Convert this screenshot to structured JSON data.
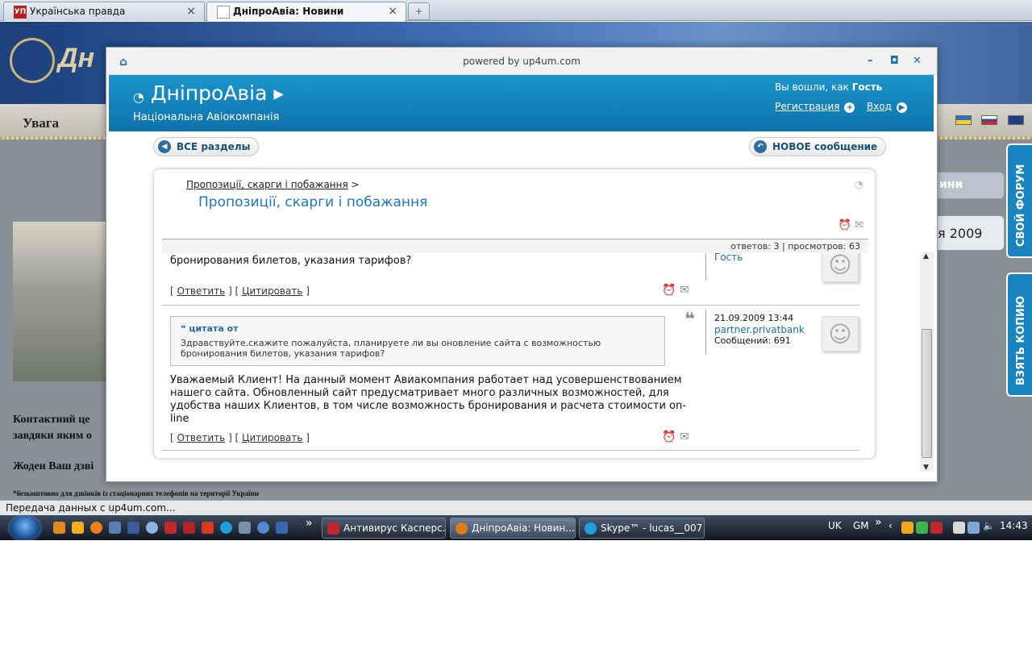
{
  "browser": {
    "tabs": [
      {
        "label": "Українська правда",
        "favicon": "УП",
        "active": false
      },
      {
        "label": "ДніпроАвіа: Новини",
        "active": true
      }
    ],
    "close_glyph": "×",
    "newtab_glyph": "+"
  },
  "site": {
    "nav_label": "Увага",
    "right_box1": "ини",
    "right_box2": "я 2009",
    "side_tab1": "СВОЙ ФОРУМ",
    "side_tab2": "ВЗЯТЬ КОПИЮ",
    "text1": "Контактний це",
    "text2": "завдяки яким о",
    "text3": "Жоден Ваш дзві",
    "footnote": "*безкоштовно для дзвінків із стаціонарних телефонів на території України"
  },
  "modal": {
    "powered": "powered by up4um.com",
    "controls": {
      "minimize": "–",
      "maximize": "◘",
      "close": "✕"
    },
    "banner": {
      "title": "ДніпроАвіа",
      "subtitle": "Національна Авіокомпанія",
      "login_prefix": "Вы вошли, как",
      "login_user": "Гость",
      "register": "Регистрация",
      "enter": "Вход"
    },
    "btn_all": "ВСЕ разделы",
    "btn_new": "НОВОЕ сообщение",
    "breadcrumb": "Пропозиції, скарги і побажання",
    "breadcrumb_sep": ">",
    "topic_title": "Пропозиції, скарги і побажання",
    "stats": "ответов: 3 | просмотров: 63",
    "posts": [
      {
        "text": "бронирования билетов, указания тарифов?",
        "user": "Гость",
        "reply": "Ответить",
        "quote": "Цитировать"
      },
      {
        "quote_header": "цитата от",
        "quote_text": "Здравствуйте.скажите пожалуйста, планируете ли вы оновление сайта с возможностью бронирования билетов, указания тарифов?",
        "date": "21.09.2009 13:44",
        "user": "partner.privatbank",
        "messages": "Сообщений: 691",
        "text": "Уважаемый Клиент! На данный момент Авиакомпания работает над усовершенствованием нашего сайта. Обновленный сайт предусматривает много различных возможностей, для удобства наших Клиентов, в том числе возможность бронирования и расчета стоимости on-line",
        "reply": "Ответить",
        "quote": "Цитировать"
      }
    ]
  },
  "status_text": "Передача данных с up4um.com...",
  "taskbar": {
    "items": [
      {
        "label": "Антивирус Касперс...",
        "color": "#c0262d"
      },
      {
        "label": "ДніпроАвіа: Новин...",
        "color": "#e07b1a"
      },
      {
        "label": "Skype™ - lucas__007",
        "color": "#1ea0dc"
      }
    ],
    "lang": "UK",
    "gm": "GM",
    "clock": "14:43",
    "overflow": "»"
  },
  "colors": {
    "accent": "#1a7ab8",
    "banner": "#0e72ac"
  }
}
